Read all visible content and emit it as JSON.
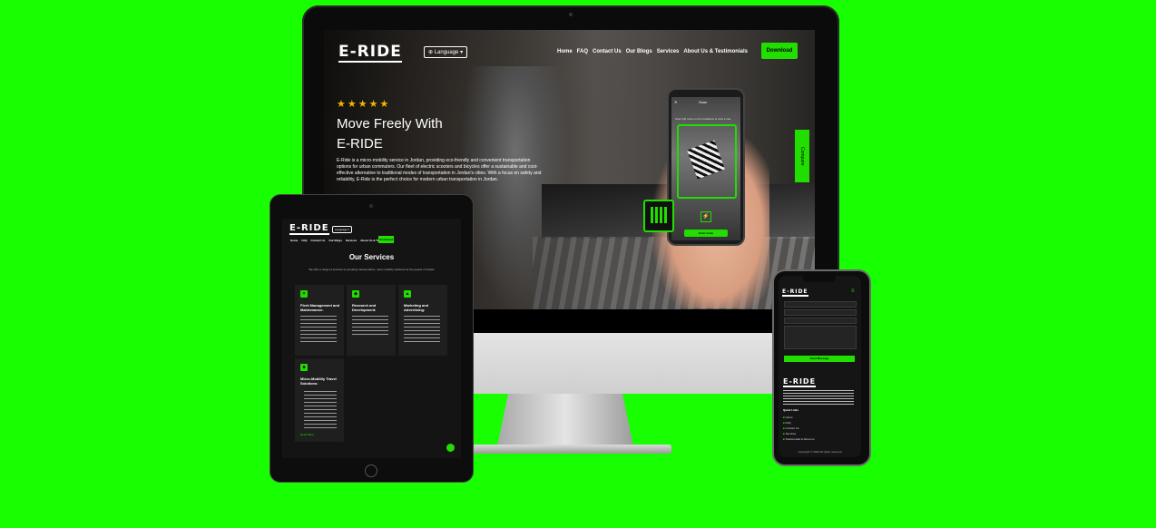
{
  "imac": {
    "logo": "E-RIDE",
    "language_label": "Language",
    "nav": [
      "Home",
      "FAQ",
      "Contact Us",
      "Our Blogs",
      "Services",
      "About Us & Testimonials"
    ],
    "download_label": "Download",
    "stars": "★★★★★",
    "hero_line1": "Move Freely With",
    "hero_line2": "E-RIDE",
    "hero_paragraph": "E-Ride is a micro-mobility service in Jordan, providing eco-friendly and convenient transportation options for urban commuters. Our fleet of electric scooters and bicycles offer a sustainable and cost-effective alternative to traditional modes of transportation in Jordan's cities. With a focus on safety and reliability, E-Ride is the perfect choice for modern urban transportation in Jordan.",
    "side_tab": "Compare",
    "scan_title": "Scan",
    "scan_hint": "Scan QR code on the handlebar to start a ride",
    "enter_code": "Enter Code",
    "apple": ""
  },
  "ipad": {
    "logo": "E-RIDE",
    "language_label": "Language",
    "nav": [
      "Home",
      "FAQ",
      "Contact Us",
      "Our Blogs",
      "Services",
      "About Us & Testimonials"
    ],
    "download_label": "Download",
    "services_title": "Our Services",
    "services_subtitle": "We offer a range of services to providing transportation, micro-mobility solutions for the people of Jordan",
    "services": [
      {
        "icon": "wrench-icon",
        "title": "Fleet Management and Maintenance:"
      },
      {
        "icon": "research-icon",
        "title": "Research and Development:"
      },
      {
        "icon": "marketing-icon",
        "title": "Marketing and Advertising:"
      },
      {
        "icon": "scooter-icon",
        "title": "Micro-Mobility Travel Solutions:"
      }
    ],
    "read_more": "Read More"
  },
  "iphone": {
    "logo": "E-RIDE",
    "submit_label": "Send Message",
    "footer_logo": "E-RIDE",
    "quick_links_title": "Quick Links",
    "links": [
      "Home",
      "FAQ",
      "Contact Us",
      "Services",
      "Testimonials & About us"
    ],
    "copyright": "Copyright © 2023 All rights reserved"
  },
  "colors": {
    "accent": "#22dd00",
    "background": "#17ff00",
    "star": "#f5b400"
  }
}
